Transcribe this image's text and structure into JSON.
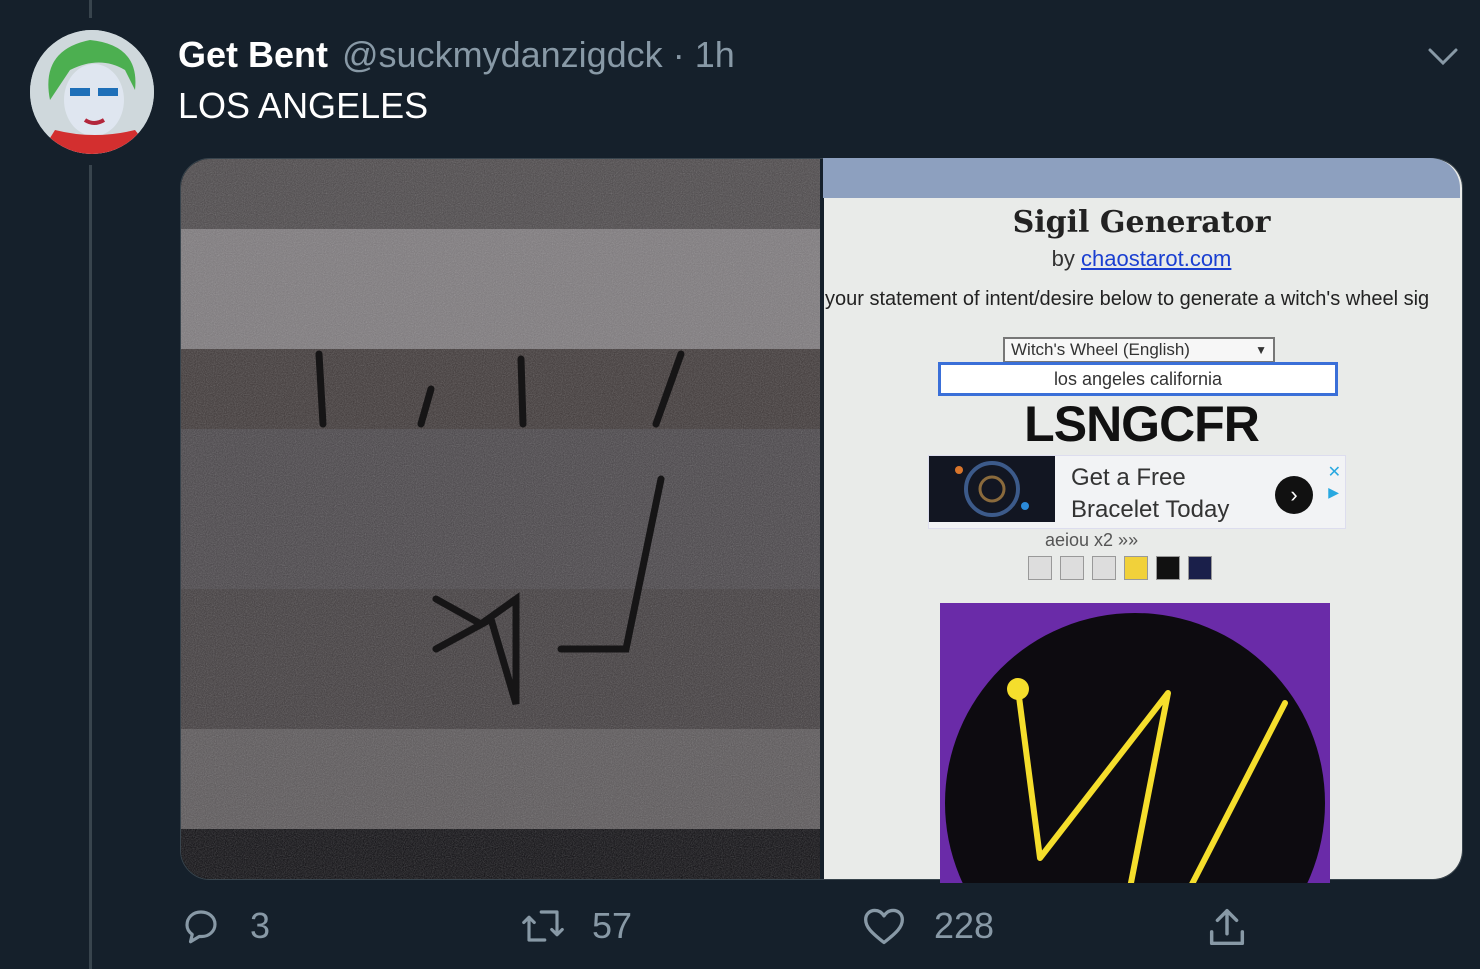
{
  "tweet": {
    "author_name": "Get Bent",
    "handle": "@suckmydanzigdck",
    "separator": "·",
    "time": "1h",
    "text": "LOS ANGELES"
  },
  "media": {
    "sigil_ui": {
      "title": "Sigil Generator",
      "by_prefix": "by",
      "by_link": "chaostarot.com",
      "instruction": "your statement of intent/desire below to generate a witch's wheel sig",
      "select_value": "Witch's Wheel (English)",
      "input_value": "los angeles california",
      "result": "LSNGCFR",
      "ad_line1": "Get a Free",
      "ad_line2": "Bracelet Today",
      "options_text": "aeiou  x2  »»"
    }
  },
  "actions": {
    "replies": "3",
    "retweets": "57",
    "likes": "228"
  },
  "icons": {
    "reply": "reply-icon",
    "retweet": "retweet-icon",
    "like": "heart-icon",
    "share": "share-icon",
    "more": "chevron-down-icon"
  },
  "colors": {
    "background": "#15202b",
    "secondary_text": "#8899a6",
    "divider": "#38444d",
    "sigil_yellow": "#f5de2c",
    "sigil_purple": "#6a2ba8"
  }
}
